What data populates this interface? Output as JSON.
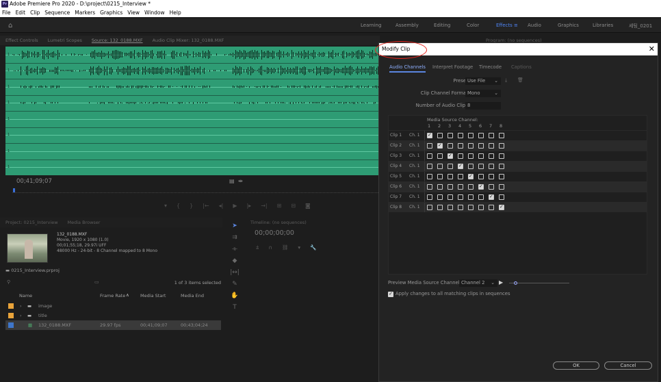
{
  "app": {
    "title": "Adobe Premiere Pro 2020 - D:\\project\\0215_Interview *",
    "logo": "Pr"
  },
  "menu": [
    "File",
    "Edit",
    "Clip",
    "Sequence",
    "Markers",
    "Graphics",
    "View",
    "Window",
    "Help"
  ],
  "workspaces": [
    "Learning",
    "Assembly",
    "Editing",
    "Color",
    "Effects",
    "Audio",
    "Graphics",
    "Libraries",
    "세팅_0201"
  ],
  "workspace_active": "Effects",
  "source_tabs": [
    "Effect Controls",
    "Lumetri Scopes",
    "Source: 132_0188.MXF",
    "Audio Clip Mixer: 132_0188.MXF"
  ],
  "source": {
    "timecode": "00;41;09;07"
  },
  "project": {
    "tabs": [
      "Project: 0215_Interview",
      "Media Browser"
    ],
    "clip": {
      "name": "132_0188.MXF",
      "line1": "Movie, 1920 x 1080 (1.0)",
      "line2": "00;01;55;18, 29.97i UFF",
      "line3": "48000 Hz - 24-bit - 8 Channel mapped to 8 Mono"
    },
    "file": "0215_Interview.prproj",
    "count": "1 of 3 items selected",
    "columns": {
      "name": "Name",
      "frame_rate": "Frame Rate",
      "media_start": "Media Start",
      "media_end": "Media End"
    },
    "items": [
      {
        "name": "image",
        "color": "#e8a33a",
        "frame_rate": "",
        "start": "",
        "end": ""
      },
      {
        "name": "title",
        "color": "#e8a33a",
        "frame_rate": "",
        "start": "",
        "end": ""
      },
      {
        "name": "132_0188.MXF",
        "color": "#3f76c9",
        "frame_rate": "29.97 fps",
        "start": "00;41;09;07",
        "end": "00;43;04;24"
      }
    ]
  },
  "timeline": {
    "tab": "Timeline: (no sequences)",
    "timecode": "00;00;00;00"
  },
  "right_panel": {
    "tab": "Program: (no sequences)"
  },
  "dialog": {
    "title": "Modify Clip",
    "tabs": [
      "Audio Channels",
      "Interpret Footage",
      "Timecode",
      "Captions"
    ],
    "preset_label": "Preset:",
    "preset_value": "Use File",
    "format_label": "Clip Channel Format:",
    "format_value": "Mono",
    "num_label": "Number of Audio Clips:",
    "num_value": "8",
    "grid_header": "Media Source Channel:",
    "channels": [
      "1",
      "2",
      "3",
      "4",
      "5",
      "6",
      "7",
      "8"
    ],
    "rows": [
      {
        "clip": "Clip 1",
        "ch": "Ch. 1",
        "checked": 1
      },
      {
        "clip": "Clip 2",
        "ch": "Ch. 1",
        "checked": 2
      },
      {
        "clip": "Clip 3",
        "ch": "Ch. 1",
        "checked": 3
      },
      {
        "clip": "Clip 4",
        "ch": "Ch. 1",
        "checked": 4
      },
      {
        "clip": "Clip 5",
        "ch": "Ch. 1",
        "checked": 5
      },
      {
        "clip": "Clip 6",
        "ch": "Ch. 1",
        "checked": 6
      },
      {
        "clip": "Clip 7",
        "ch": "Ch. 1",
        "checked": 7
      },
      {
        "clip": "Clip 8",
        "ch": "Ch. 1",
        "checked": 8
      }
    ],
    "preview_label": "Preview Media Source Channel:",
    "preview_value": "Channel 2",
    "apply_label": "Apply changes to all matching clips in sequences",
    "ok": "OK",
    "cancel": "Cancel"
  }
}
